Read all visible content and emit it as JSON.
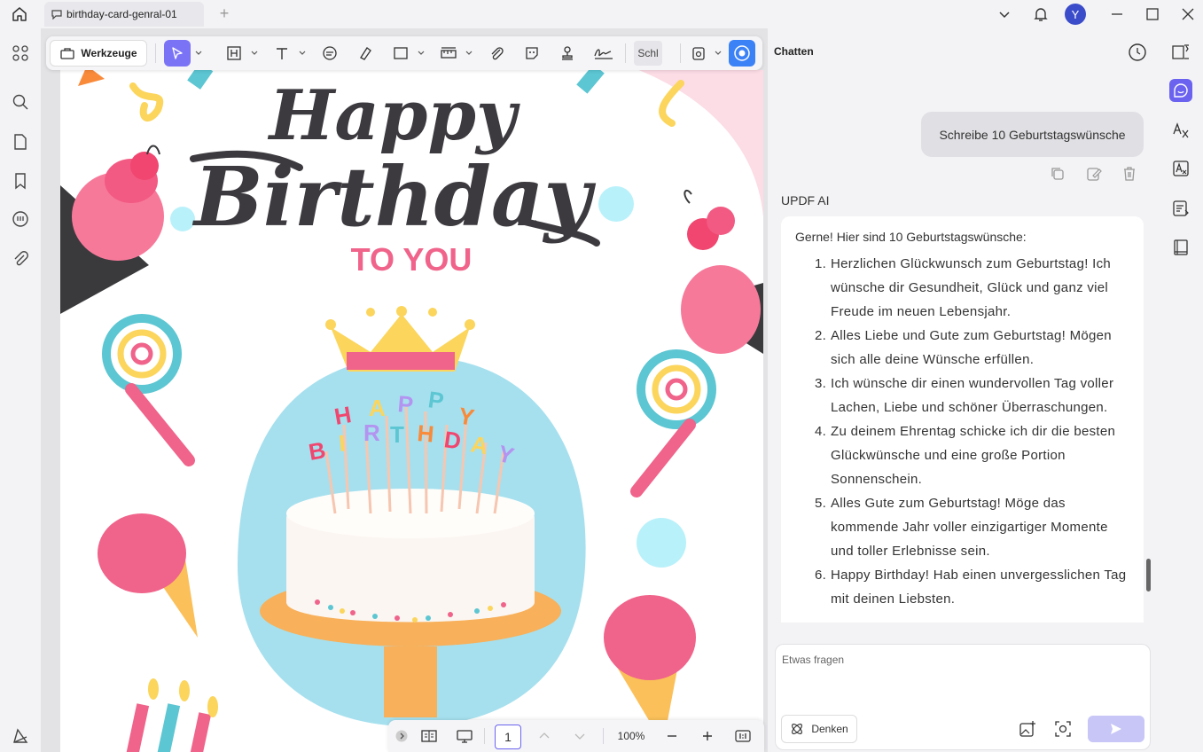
{
  "titlebar": {
    "tab_title": "birthday-card-genral-01",
    "avatar_letter": "Y"
  },
  "toolbar": {
    "tools_label": "Werkzeuge",
    "truncated_label": "Schl"
  },
  "bottom_bar": {
    "page_number": "1",
    "zoom": "100%"
  },
  "card": {
    "happy": "Happy",
    "birthday": "Birthday",
    "to_you": "TO YOU",
    "candle_letters": [
      "H",
      "A",
      "P",
      "P",
      "Y",
      "B",
      "I",
      "R",
      "T",
      "H",
      "D",
      "A",
      "Y"
    ]
  },
  "chat": {
    "title": "Chatten",
    "user_message": "Schreibe 10 Geburtstagswünsche",
    "ai_label": "UPDF AI",
    "ai_intro": "Gerne! Hier sind 10 Geburtstagswünsche:",
    "wishes": [
      {
        "num": "1.",
        "text": "Herzlichen Glückwunsch zum Geburtstag! Ich wünsche dir Gesundheit, Glück und ganz viel Freude im neuen Lebensjahr."
      },
      {
        "num": "2.",
        "text": "Alles Liebe und Gute zum Geburtstag! Mögen sich alle deine Wünsche erfüllen."
      },
      {
        "num": "3.",
        "text": "Ich wünsche dir einen wundervollen Tag voller Lachen, Liebe und schöner Überraschungen."
      },
      {
        "num": "4.",
        "text": "Zu deinem Ehrentag schicke ich dir die besten Glückwünsche und eine große Portion Sonnenschein."
      },
      {
        "num": "5.",
        "text": "Alles Gute zum Geburtstag! Möge das kommende Jahr voller einzigartiger Momente und toller Erlebnisse sein."
      },
      {
        "num": "6.",
        "text": "Happy Birthday! Hab einen unvergesslichen Tag mit deinen Liebsten."
      }
    ],
    "input_placeholder": "Etwas fragen",
    "think_label": "Denken"
  },
  "colors": {
    "accent": "#6b63f0",
    "avatar": "#3b4cca",
    "pink": "#f0638a",
    "dark_text": "#3d3a3f"
  }
}
